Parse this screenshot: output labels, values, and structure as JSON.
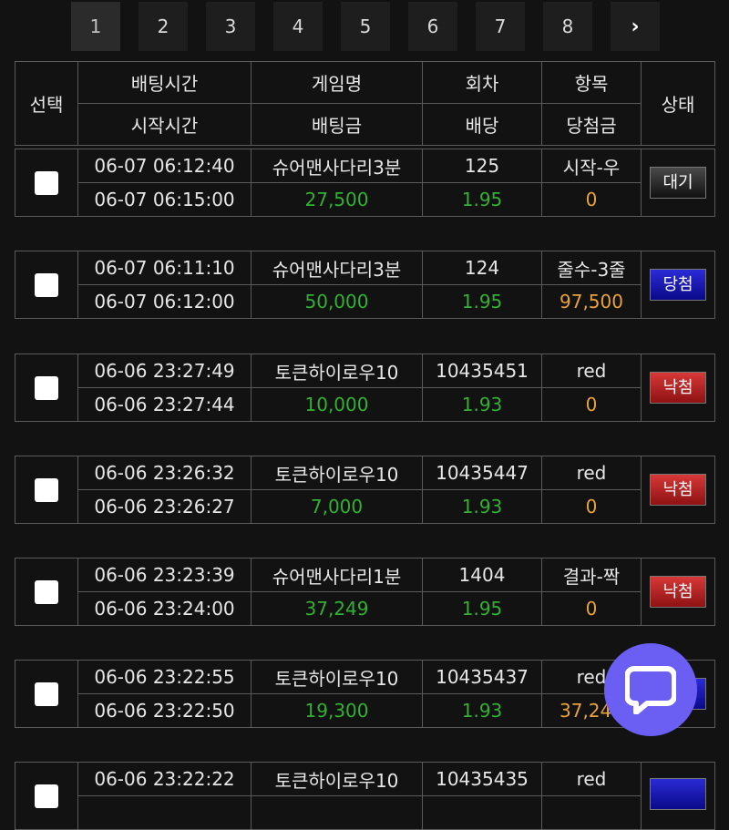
{
  "pagination": {
    "pages": [
      "1",
      "2",
      "3",
      "4",
      "5",
      "6",
      "7",
      "8"
    ],
    "active": "1",
    "next_glyph": "›"
  },
  "header": {
    "select": "선택",
    "bet_time": "배팅시간",
    "game_name": "게임명",
    "round": "회차",
    "item": "항목",
    "status": "상태",
    "start_time": "시작시간",
    "bet_amount": "배팅금",
    "odds": "배당",
    "win_amount": "당첨금"
  },
  "bets": [
    {
      "bet_time": "06-07 06:12:40",
      "start_time": "06-07 06:15:00",
      "game": "슈어맨사다리3분",
      "amount": "27,500",
      "round": "125",
      "odds": "1.95",
      "item": "시작-우",
      "win": "0",
      "status": "대기",
      "status_type": "wait"
    },
    {
      "bet_time": "06-07 06:11:10",
      "start_time": "06-07 06:12:00",
      "game": "슈어맨사다리3분",
      "amount": "50,000",
      "round": "124",
      "odds": "1.95",
      "item": "줄수-3줄",
      "win": "97,500",
      "status": "당첨",
      "status_type": "win"
    },
    {
      "bet_time": "06-06 23:27:49",
      "start_time": "06-06 23:27:44",
      "game": "토큰하이로우10",
      "amount": "10,000",
      "round": "10435451",
      "odds": "1.93",
      "item": "red",
      "win": "0",
      "status": "낙첨",
      "status_type": "lose"
    },
    {
      "bet_time": "06-06 23:26:32",
      "start_time": "06-06 23:26:27",
      "game": "토큰하이로우10",
      "amount": "7,000",
      "round": "10435447",
      "odds": "1.93",
      "item": "red",
      "win": "0",
      "status": "낙첨",
      "status_type": "lose"
    },
    {
      "bet_time": "06-06 23:23:39",
      "start_time": "06-06 23:24:00",
      "game": "슈어맨사다리1분",
      "amount": "37,249",
      "round": "1404",
      "odds": "1.95",
      "item": "결과-짝",
      "win": "0",
      "status": "낙첨",
      "status_type": "lose"
    },
    {
      "bet_time": "06-06 23:22:55",
      "start_time": "06-06 23:22:50",
      "game": "토큰하이로우10",
      "amount": "19,300",
      "round": "10435437",
      "odds": "1.93",
      "item": "red",
      "win": "37,249",
      "status": "당첨",
      "status_type": "win"
    },
    {
      "bet_time": "06-06 23:22:22",
      "start_time": "",
      "game": "토큰하이로우10",
      "amount": "",
      "round": "10435435",
      "odds": "",
      "item": "red",
      "win": "",
      "status": "",
      "status_type": "win"
    }
  ],
  "colors": {
    "background": "#121212",
    "amount_green": "#33b033",
    "win_orange": "#e8a23c",
    "status_wait": "#2a2a2a",
    "status_win": "#1a1ab8",
    "status_lose": "#b82222",
    "chat_button": "#6a5ff2"
  },
  "chat": {
    "icon": "chat-bubble-icon"
  }
}
